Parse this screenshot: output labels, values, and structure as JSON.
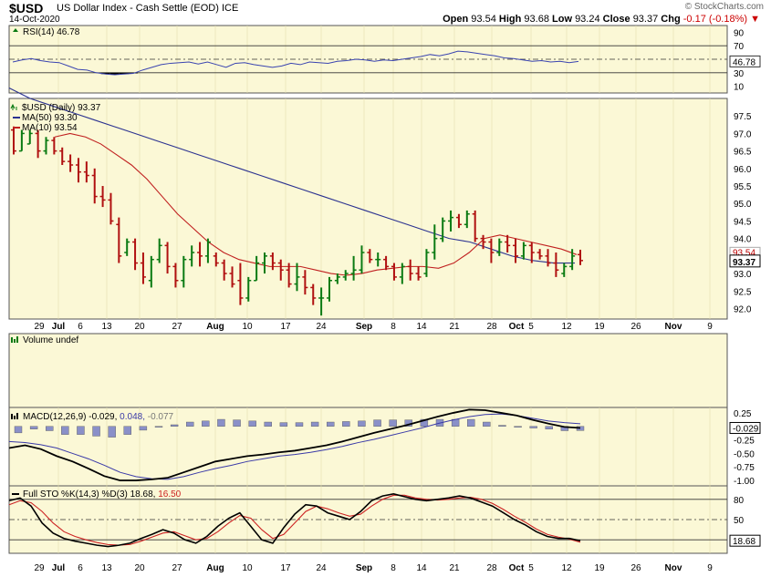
{
  "header": {
    "symbol": "$USD",
    "description": "US Dollar Index - Cash Settle (EOD)",
    "exchange": "ICE",
    "date": "14-Oct-2020",
    "credit": "© StockCharts.com",
    "open_label": "Open",
    "open": "93.54",
    "high_label": "High",
    "high": "93.68",
    "low_label": "Low",
    "low": "93.24",
    "close_label": "Close",
    "close": "93.37",
    "chg_label": "Chg",
    "chg": "-0.17 (-0.18%)",
    "up_arrow": "▼"
  },
  "colors": {
    "panel_bg": "#fbf8d6",
    "up_bar": "#0a7a12",
    "down_bar": "#b01010",
    "ma50": "#2a3190",
    "ma10": "#c02020",
    "rsi_line": "#3a44b0",
    "macd_line": "#000000",
    "signal_line": "#3a3aa8",
    "histogram": "#8a90c8",
    "stok": "#000000",
    "stod": "#cc2222"
  },
  "x_axis_labels": [
    "29",
    "Jul",
    "6",
    "13",
    "20",
    "27",
    "Aug",
    "10",
    "17",
    "24",
    "Sep",
    "8",
    "14",
    "21",
    "28",
    "Oct",
    "5",
    "12",
    "19",
    "26",
    "Nov",
    "9"
  ],
  "chart_data": [
    {
      "type": "line",
      "title": "RSI(14) 46.78",
      "series": [
        {
          "name": "RSI(14)",
          "values": [
            46,
            49,
            51,
            48,
            46,
            45,
            40,
            35,
            34,
            30,
            28,
            27,
            28,
            29,
            34,
            38,
            42,
            44,
            45,
            46,
            43,
            46,
            42,
            38,
            44,
            45,
            42,
            40,
            38,
            40,
            44,
            42,
            46,
            45,
            44,
            47,
            48,
            50,
            49,
            47,
            49,
            48,
            50,
            52,
            54,
            57,
            55,
            58,
            62,
            61,
            59,
            57,
            55,
            52,
            51,
            49,
            47,
            48,
            46,
            47,
            45,
            46.78
          ]
        }
      ],
      "y_ticks": [
        90,
        70,
        50,
        30,
        10
      ],
      "ylim": [
        0,
        100
      ],
      "last_value": "46.78"
    },
    {
      "type": "bar",
      "title": "$USD (Daily) 93.37",
      "legend": [
        "MA(50) 93.30",
        "MA(10) 93.54"
      ],
      "bars": [
        [
          97.1,
          97.2,
          96.4,
          96.5
        ],
        [
          96.5,
          97.1,
          96.5,
          97.0
        ],
        [
          96.7,
          97.1,
          96.7,
          97.0
        ],
        [
          97.0,
          97.1,
          96.3,
          96.5
        ],
        [
          96.5,
          96.9,
          96.4,
          96.8
        ],
        [
          96.8,
          96.9,
          96.4,
          96.5
        ],
        [
          96.5,
          96.6,
          96.1,
          96.2
        ],
        [
          96.2,
          96.4,
          95.9,
          96.1
        ],
        [
          96.1,
          96.3,
          95.6,
          95.9
        ],
        [
          95.9,
          96.2,
          95.6,
          95.8
        ],
        [
          95.8,
          96.0,
          95.0,
          95.2
        ],
        [
          95.2,
          95.5,
          94.9,
          95.1
        ],
        [
          95.1,
          95.3,
          94.4,
          94.5
        ],
        [
          94.4,
          94.6,
          93.3,
          93.5
        ],
        [
          93.6,
          94.0,
          93.5,
          93.9
        ],
        [
          93.9,
          94.0,
          93.1,
          93.3
        ],
        [
          93.3,
          93.6,
          92.7,
          92.9
        ],
        [
          92.8,
          93.5,
          92.6,
          93.4
        ],
        [
          93.4,
          94.0,
          93.3,
          93.8
        ],
        [
          93.8,
          93.9,
          93.0,
          93.2
        ],
        [
          93.2,
          93.3,
          92.6,
          92.8
        ],
        [
          92.8,
          93.5,
          92.6,
          93.4
        ],
        [
          93.4,
          93.8,
          93.2,
          93.6
        ],
        [
          93.6,
          93.9,
          93.2,
          93.5
        ],
        [
          93.5,
          94.0,
          93.3,
          93.9
        ],
        [
          93.5,
          93.6,
          93.2,
          93.3
        ],
        [
          93.3,
          93.4,
          92.8,
          93.0
        ],
        [
          93.0,
          93.2,
          92.6,
          92.7
        ],
        [
          92.8,
          93.3,
          92.1,
          92.3
        ],
        [
          92.3,
          92.9,
          92.2,
          92.8
        ],
        [
          92.8,
          93.5,
          92.8,
          93.3
        ],
        [
          93.3,
          93.6,
          93.0,
          93.5
        ],
        [
          93.5,
          93.6,
          93.1,
          93.3
        ],
        [
          93.3,
          93.4,
          92.8,
          93.1
        ],
        [
          93.1,
          93.3,
          92.6,
          92.7
        ],
        [
          92.7,
          93.3,
          92.5,
          92.9
        ],
        [
          92.9,
          93.1,
          92.4,
          92.6
        ],
        [
          92.6,
          92.7,
          92.1,
          92.3
        ],
        [
          92.3,
          92.6,
          91.8,
          92.3
        ],
        [
          92.3,
          92.9,
          92.2,
          92.8
        ],
        [
          92.8,
          93.0,
          92.7,
          92.9
        ],
        [
          92.9,
          93.1,
          92.8,
          93.0
        ],
        [
          93.0,
          93.5,
          92.8,
          93.1
        ],
        [
          93.1,
          93.8,
          93.0,
          93.6
        ],
        [
          93.6,
          93.7,
          93.3,
          93.4
        ],
        [
          93.4,
          93.6,
          93.2,
          93.4
        ],
        [
          93.4,
          93.5,
          93.1,
          93.2
        ],
        [
          93.2,
          93.3,
          92.8,
          92.9
        ],
        [
          92.9,
          93.3,
          92.7,
          93.2
        ],
        [
          93.2,
          93.4,
          92.8,
          93.0
        ],
        [
          93.0,
          93.2,
          92.8,
          92.9
        ],
        [
          93.0,
          93.7,
          92.9,
          93.6
        ],
        [
          93.6,
          94.4,
          93.4,
          94.0
        ],
        [
          94.0,
          94.6,
          93.9,
          94.5
        ],
        [
          94.5,
          94.8,
          94.2,
          94.6
        ],
        [
          94.6,
          94.7,
          94.3,
          94.4
        ],
        [
          94.4,
          94.8,
          94.3,
          94.7
        ],
        [
          94.7,
          94.8,
          93.9,
          94.0
        ],
        [
          94.0,
          94.1,
          93.7,
          93.9
        ],
        [
          93.9,
          94.0,
          93.3,
          93.6
        ],
        [
          93.6,
          94.0,
          93.5,
          93.9
        ],
        [
          93.9,
          94.1,
          93.6,
          93.8
        ],
        [
          93.8,
          94.0,
          93.3,
          93.5
        ],
        [
          93.5,
          93.9,
          93.4,
          93.8
        ],
        [
          93.8,
          93.9,
          93.3,
          93.6
        ],
        [
          93.6,
          93.7,
          93.4,
          93.5
        ],
        [
          93.5,
          93.7,
          93.2,
          93.3
        ],
        [
          93.3,
          93.6,
          92.9,
          93.1
        ],
        [
          93.0,
          93.3,
          92.9,
          93.2
        ],
        [
          93.2,
          93.7,
          93.1,
          93.5
        ],
        [
          93.54,
          93.68,
          93.24,
          93.37
        ]
      ],
      "ma50_values": [
        98.3,
        98.0,
        97.8,
        97.6,
        97.4,
        97.2,
        97.0,
        96.8,
        96.6,
        96.4,
        96.2,
        96.0,
        95.8,
        95.6,
        95.4,
        95.2,
        95.0,
        94.8,
        94.6,
        94.4,
        94.2,
        94.0,
        93.9,
        93.7,
        93.5,
        93.37,
        93.3,
        93.3
      ],
      "ma10_values": [
        96.9,
        97.0,
        96.9,
        96.7,
        96.4,
        96.1,
        95.7,
        95.2,
        94.7,
        94.3,
        93.9,
        93.6,
        93.4,
        93.3,
        93.2,
        93.2,
        93.2,
        93.1,
        93.0,
        92.95,
        93.0,
        93.1,
        93.15,
        93.2,
        93.2,
        93.15,
        93.3,
        93.6,
        94.0,
        94.1,
        94.0,
        93.9,
        93.8,
        93.7,
        93.54
      ],
      "y_ticks": [
        97.5,
        97.0,
        96.5,
        96.0,
        95.5,
        95.0,
        94.5,
        94.0,
        93.5,
        93.0,
        92.5,
        92.0
      ],
      "ylim": [
        91.7,
        98.0
      ],
      "last_value": "93.37",
      "ma_marker": "93.54"
    },
    {
      "type": "bar",
      "title": "Volume undef",
      "values": []
    },
    {
      "type": "line",
      "title": "MACD(12,26,9) -0.029, 0.048, -0.077",
      "title_parts": [
        "MACD(12,26,9)",
        "-0.029,",
        "0.048,",
        "-0.077"
      ],
      "series": [
        {
          "name": "MACD",
          "values": [
            -0.4,
            -0.35,
            -0.42,
            -0.55,
            -0.65,
            -0.78,
            -0.92,
            -1.0,
            -1.0,
            -0.98,
            -0.95,
            -0.85,
            -0.75,
            -0.65,
            -0.6,
            -0.55,
            -0.52,
            -0.48,
            -0.45,
            -0.4,
            -0.35,
            -0.28,
            -0.2,
            -0.12,
            -0.05,
            0.02,
            0.1,
            0.18,
            0.25,
            0.31,
            0.3,
            0.25,
            0.2,
            0.12,
            0.05,
            -0.01,
            -0.029
          ]
        },
        {
          "name": "Signal",
          "values": [
            -0.28,
            -0.3,
            -0.34,
            -0.4,
            -0.5,
            -0.6,
            -0.72,
            -0.85,
            -0.93,
            -0.97,
            -0.98,
            -0.93,
            -0.85,
            -0.78,
            -0.72,
            -0.65,
            -0.6,
            -0.55,
            -0.52,
            -0.48,
            -0.43,
            -0.37,
            -0.3,
            -0.24,
            -0.17,
            -0.1,
            -0.03,
            0.05,
            0.12,
            0.18,
            0.22,
            0.23,
            0.2,
            0.15,
            0.1,
            0.07,
            0.048
          ]
        },
        {
          "name": "Histogram",
          "values": [
            -0.12,
            -0.05,
            -0.08,
            -0.15,
            -0.15,
            -0.18,
            -0.2,
            -0.15,
            -0.07,
            -0.01,
            0.03,
            0.08,
            0.1,
            0.13,
            0.12,
            0.1,
            0.08,
            0.07,
            0.07,
            0.08,
            0.08,
            0.09,
            0.1,
            0.12,
            0.12,
            0.12,
            0.13,
            0.13,
            0.13,
            0.13,
            0.08,
            0.02,
            0.0,
            -0.03,
            -0.05,
            -0.08,
            -0.077
          ]
        }
      ],
      "y_ticks": [
        "0.25",
        "0.00",
        "-0.25",
        "-0.50",
        "-0.75",
        "-1.00"
      ],
      "ylim": [
        -1.1,
        0.35
      ],
      "last_value": "-0.029"
    },
    {
      "type": "line",
      "title": "Full STO %K(14,3) %D(3) 18.68, 16.50",
      "title_parts": [
        "Full STO %K(14,3) %D(3)",
        "18.68,",
        "16.50"
      ],
      "series": [
        {
          "name": "%K",
          "values": [
            78,
            82,
            70,
            45,
            30,
            22,
            18,
            15,
            12,
            10,
            12,
            15,
            22,
            28,
            35,
            30,
            20,
            15,
            25,
            40,
            52,
            60,
            40,
            20,
            15,
            38,
            58,
            72,
            70,
            60,
            55,
            50,
            62,
            78,
            85,
            88,
            84,
            80,
            78,
            80,
            82,
            85,
            82,
            76,
            70,
            60,
            50,
            42,
            32,
            25,
            22,
            22,
            18.68
          ]
        },
        {
          "name": "%D",
          "values": [
            72,
            78,
            75,
            62,
            45,
            32,
            25,
            20,
            16,
            13,
            12,
            13,
            18,
            24,
            30,
            32,
            26,
            20,
            22,
            32,
            45,
            56,
            52,
            35,
            22,
            28,
            45,
            62,
            70,
            66,
            60,
            55,
            58,
            70,
            80,
            86,
            86,
            82,
            80,
            79,
            80,
            82,
            83,
            80,
            74,
            65,
            55,
            46,
            36,
            28,
            24,
            21,
            16.5
          ]
        }
      ],
      "y_ticks": [
        80,
        50,
        20
      ],
      "ylim": [
        0,
        100
      ],
      "last_value": "18.68"
    }
  ]
}
